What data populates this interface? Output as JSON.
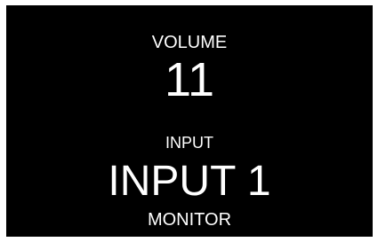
{
  "display": {
    "volume_label": "VOLUME",
    "volume_value": "11",
    "input_label": "INPUT",
    "input_value": "INPUT 1",
    "mode": "MONITOR"
  },
  "colors": {
    "background": "#000000",
    "text": "#ffffff"
  }
}
